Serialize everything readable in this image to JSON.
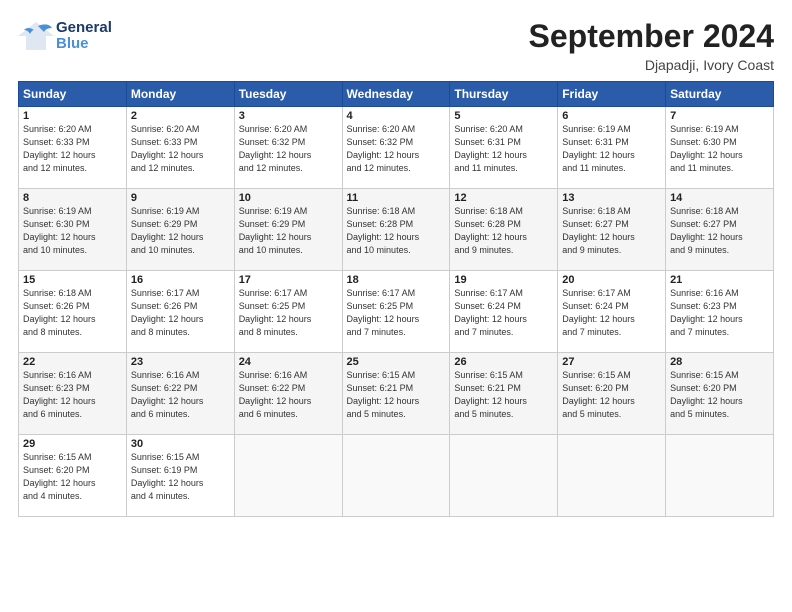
{
  "logo": {
    "general": "General",
    "blue": "Blue"
  },
  "title": "September 2024",
  "subtitle": "Djapadji, Ivory Coast",
  "days_header": [
    "Sunday",
    "Monday",
    "Tuesday",
    "Wednesday",
    "Thursday",
    "Friday",
    "Saturday"
  ],
  "weeks": [
    [
      {
        "day": "1",
        "info": "Sunrise: 6:20 AM\nSunset: 6:33 PM\nDaylight: 12 hours\nand 12 minutes."
      },
      {
        "day": "2",
        "info": "Sunrise: 6:20 AM\nSunset: 6:33 PM\nDaylight: 12 hours\nand 12 minutes."
      },
      {
        "day": "3",
        "info": "Sunrise: 6:20 AM\nSunset: 6:32 PM\nDaylight: 12 hours\nand 12 minutes."
      },
      {
        "day": "4",
        "info": "Sunrise: 6:20 AM\nSunset: 6:32 PM\nDaylight: 12 hours\nand 12 minutes."
      },
      {
        "day": "5",
        "info": "Sunrise: 6:20 AM\nSunset: 6:31 PM\nDaylight: 12 hours\nand 11 minutes."
      },
      {
        "day": "6",
        "info": "Sunrise: 6:19 AM\nSunset: 6:31 PM\nDaylight: 12 hours\nand 11 minutes."
      },
      {
        "day": "7",
        "info": "Sunrise: 6:19 AM\nSunset: 6:30 PM\nDaylight: 12 hours\nand 11 minutes."
      }
    ],
    [
      {
        "day": "8",
        "info": "Sunrise: 6:19 AM\nSunset: 6:30 PM\nDaylight: 12 hours\nand 10 minutes."
      },
      {
        "day": "9",
        "info": "Sunrise: 6:19 AM\nSunset: 6:29 PM\nDaylight: 12 hours\nand 10 minutes."
      },
      {
        "day": "10",
        "info": "Sunrise: 6:19 AM\nSunset: 6:29 PM\nDaylight: 12 hours\nand 10 minutes."
      },
      {
        "day": "11",
        "info": "Sunrise: 6:18 AM\nSunset: 6:28 PM\nDaylight: 12 hours\nand 10 minutes."
      },
      {
        "day": "12",
        "info": "Sunrise: 6:18 AM\nSunset: 6:28 PM\nDaylight: 12 hours\nand 9 minutes."
      },
      {
        "day": "13",
        "info": "Sunrise: 6:18 AM\nSunset: 6:27 PM\nDaylight: 12 hours\nand 9 minutes."
      },
      {
        "day": "14",
        "info": "Sunrise: 6:18 AM\nSunset: 6:27 PM\nDaylight: 12 hours\nand 9 minutes."
      }
    ],
    [
      {
        "day": "15",
        "info": "Sunrise: 6:18 AM\nSunset: 6:26 PM\nDaylight: 12 hours\nand 8 minutes."
      },
      {
        "day": "16",
        "info": "Sunrise: 6:17 AM\nSunset: 6:26 PM\nDaylight: 12 hours\nand 8 minutes."
      },
      {
        "day": "17",
        "info": "Sunrise: 6:17 AM\nSunset: 6:25 PM\nDaylight: 12 hours\nand 8 minutes."
      },
      {
        "day": "18",
        "info": "Sunrise: 6:17 AM\nSunset: 6:25 PM\nDaylight: 12 hours\nand 7 minutes."
      },
      {
        "day": "19",
        "info": "Sunrise: 6:17 AM\nSunset: 6:24 PM\nDaylight: 12 hours\nand 7 minutes."
      },
      {
        "day": "20",
        "info": "Sunrise: 6:17 AM\nSunset: 6:24 PM\nDaylight: 12 hours\nand 7 minutes."
      },
      {
        "day": "21",
        "info": "Sunrise: 6:16 AM\nSunset: 6:23 PM\nDaylight: 12 hours\nand 7 minutes."
      }
    ],
    [
      {
        "day": "22",
        "info": "Sunrise: 6:16 AM\nSunset: 6:23 PM\nDaylight: 12 hours\nand 6 minutes."
      },
      {
        "day": "23",
        "info": "Sunrise: 6:16 AM\nSunset: 6:22 PM\nDaylight: 12 hours\nand 6 minutes."
      },
      {
        "day": "24",
        "info": "Sunrise: 6:16 AM\nSunset: 6:22 PM\nDaylight: 12 hours\nand 6 minutes."
      },
      {
        "day": "25",
        "info": "Sunrise: 6:15 AM\nSunset: 6:21 PM\nDaylight: 12 hours\nand 5 minutes."
      },
      {
        "day": "26",
        "info": "Sunrise: 6:15 AM\nSunset: 6:21 PM\nDaylight: 12 hours\nand 5 minutes."
      },
      {
        "day": "27",
        "info": "Sunrise: 6:15 AM\nSunset: 6:20 PM\nDaylight: 12 hours\nand 5 minutes."
      },
      {
        "day": "28",
        "info": "Sunrise: 6:15 AM\nSunset: 6:20 PM\nDaylight: 12 hours\nand 5 minutes."
      }
    ],
    [
      {
        "day": "29",
        "info": "Sunrise: 6:15 AM\nSunset: 6:20 PM\nDaylight: 12 hours\nand 4 minutes."
      },
      {
        "day": "30",
        "info": "Sunrise: 6:15 AM\nSunset: 6:19 PM\nDaylight: 12 hours\nand 4 minutes."
      },
      {
        "day": "",
        "info": ""
      },
      {
        "day": "",
        "info": ""
      },
      {
        "day": "",
        "info": ""
      },
      {
        "day": "",
        "info": ""
      },
      {
        "day": "",
        "info": ""
      }
    ]
  ]
}
